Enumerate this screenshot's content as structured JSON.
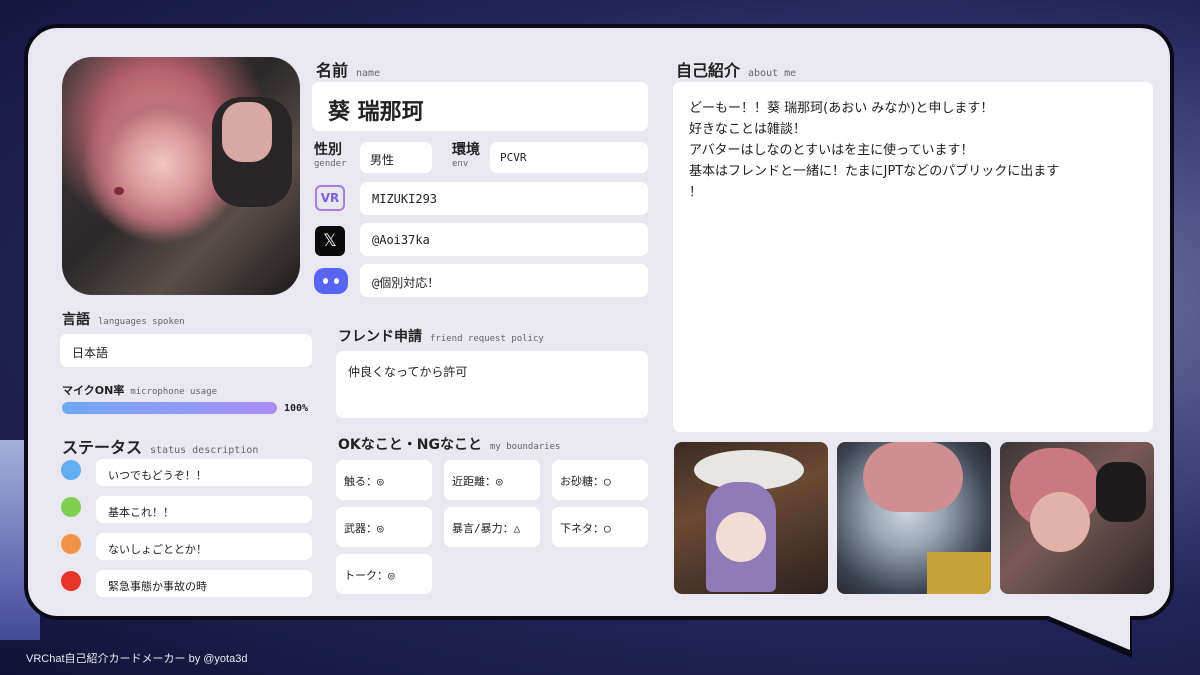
{
  "profile": {
    "name_label": "名前",
    "name_label_en": "name",
    "name": "葵 瑞那珂",
    "gender_label": "性別",
    "gender_label_en": "gender",
    "gender": "男性",
    "env_label": "環境",
    "env_label_en": "env",
    "env": "PCVR",
    "vrchat_id": "MIZUKI293",
    "x_handle": "@Aoi37ka",
    "discord": "@個別対応！",
    "vr_badge": "VR",
    "x_glyph": "𝕏"
  },
  "languages": {
    "label": "言語",
    "label_en": "languages spoken",
    "value": "日本語"
  },
  "mic": {
    "label": "マイクON率",
    "label_en": "microphone usage",
    "percent_text": "100%",
    "level": 1.0
  },
  "status": {
    "label": "ステータス",
    "label_en": "status description",
    "items": [
      {
        "color": "#62aef0",
        "text": "いつでもどうぞ！！"
      },
      {
        "color": "#7fd04f",
        "text": "基本これ！！"
      },
      {
        "color": "#f09248",
        "text": "ないしょごととか！"
      },
      {
        "color": "#e8352c",
        "text": "緊急事態か事故の時"
      }
    ]
  },
  "friend_request": {
    "label": "フレンド申請",
    "label_en": "friend request policy",
    "value": "仲良くなってから許可"
  },
  "boundaries": {
    "label": "OKなこと・NGなこと",
    "label_en": "my boundaries",
    "items": [
      "触る：◎",
      "近距離：◎",
      "お砂糖：◯",
      "武器：◎",
      "暴言/暴力：△",
      "下ネタ：◯",
      "トーク：◎"
    ]
  },
  "about": {
    "label": "自己紹介",
    "label_en": "about me",
    "lines": [
      "どーもー！！葵 瑞那珂(あおい みなか)と申します！",
      "好きなことは雑談！",
      "アバターはしなのとすいはを主に使っています！",
      "基本はフレンドと一緒に！たまにJPTなどのパブリックに出ます",
      "！"
    ]
  },
  "footer": "VRChat自己紹介カードメーカー by @yota3d",
  "colors": {
    "card_bg": "#e9e8f0",
    "mic_bar_start": "#6fa8f0",
    "mic_bar_end": "#a98cf0",
    "discord": "#5865f2"
  }
}
